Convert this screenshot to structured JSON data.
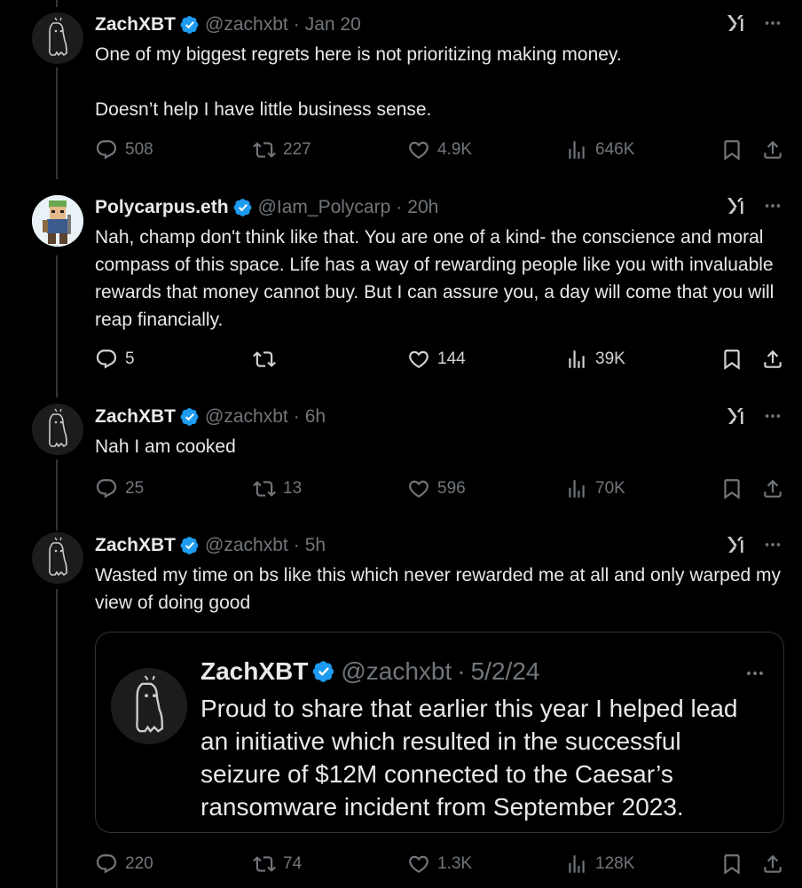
{
  "colors": {
    "background": "#000000",
    "text": "#e7e9ea",
    "muted": "#71767b",
    "verified": "#1d9bf0",
    "border": "#2f3336"
  },
  "tweets": [
    {
      "name": "ZachXBT",
      "handle": "@zachxbt",
      "time": "Jan 20",
      "text": "One of my biggest regrets here is not prioritizing making money.\n\nDoesn’t help I have little business sense.",
      "replies": "508",
      "reposts": "227",
      "likes": "4.9K",
      "views": "646K"
    },
    {
      "name": "Polycarpus.eth",
      "handle": "@Iam_Polycarp",
      "time": "20h",
      "text": "Nah, champ don't think like that. You are one of a kind- the conscience and moral compass of this space. Life has a way of rewarding people like you with invaluable rewards that money cannot buy. But I can assure you, a day will come that you will reap financially.",
      "replies": "5",
      "reposts": "",
      "likes": "144",
      "views": "39K"
    },
    {
      "name": "ZachXBT",
      "handle": "@zachxbt",
      "time": "6h",
      "text": "Nah I am cooked",
      "replies": "25",
      "reposts": "13",
      "likes": "596",
      "views": "70K"
    },
    {
      "name": "ZachXBT",
      "handle": "@zachxbt",
      "time": "5h",
      "text": "Wasted my time on bs like this which never rewarded me at all and only warped my view of doing good",
      "replies": "220",
      "reposts": "74",
      "likes": "1.3K",
      "views": "128K",
      "quote": {
        "name": "ZachXBT",
        "handle": "@zachxbt",
        "time": "5/2/24",
        "text": "Proud to share that earlier this year I helped lead an initiative which resulted in the successful seizure of $12M connected to the Caesar’s ransomware incident from September 2023."
      }
    }
  ]
}
